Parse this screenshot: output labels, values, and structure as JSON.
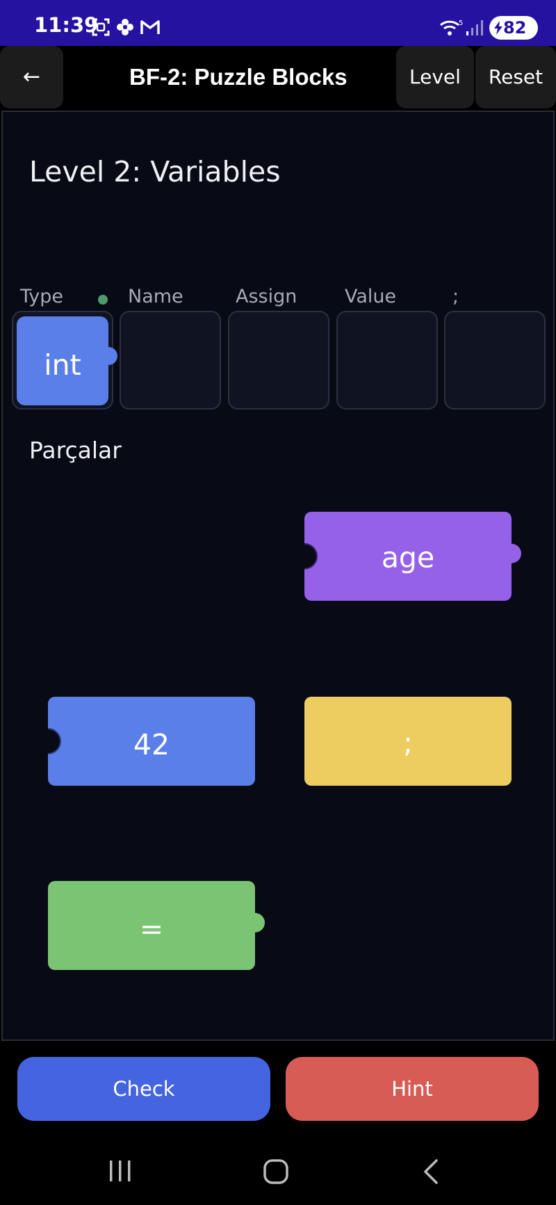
{
  "status_bar": {
    "time": "11:39",
    "battery": "82",
    "left_icons": [
      "screenshot-icon",
      "flower-icon",
      "gmail-icon"
    ],
    "right_icons": [
      "wifi-icon",
      "signal-icon",
      "battery-icon"
    ]
  },
  "app_bar": {
    "back_label": "←",
    "title": "BF-2: Puzzle Blocks",
    "level_label": "Level",
    "reset_label": "Reset"
  },
  "game": {
    "level_title": "Level 2: Variables",
    "slot_labels": [
      "Type",
      "Name",
      "Assign",
      "Value",
      ";"
    ],
    "placed_block": {
      "text": "int",
      "color": "#5b7fe8"
    },
    "pieces_label": "Parçalar",
    "pieces": [
      {
        "text": "age",
        "color": "#9561e8"
      },
      {
        "text": "42",
        "color": "#5b7fe8"
      },
      {
        "text": ";",
        "color": "#edcd60"
      },
      {
        "text": "=",
        "color": "#7bc474"
      }
    ]
  },
  "actions": {
    "check_label": "Check",
    "check_color": "#4565e0",
    "hint_label": "Hint",
    "hint_color": "#d65c55"
  },
  "nav_bar": {
    "icons": [
      "recent-apps-icon",
      "home-icon",
      "back-nav-icon"
    ]
  }
}
